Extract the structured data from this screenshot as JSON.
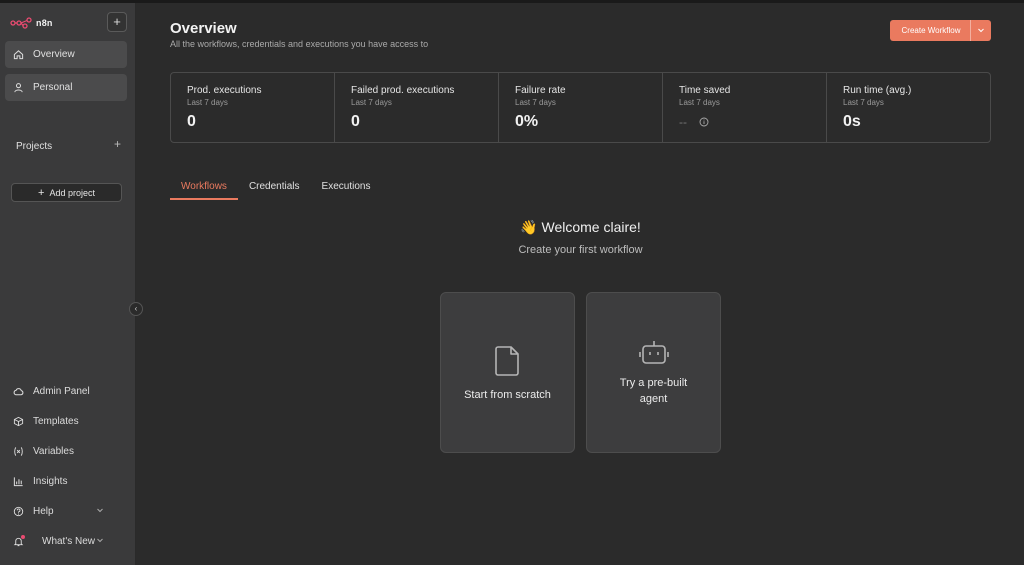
{
  "app": {
    "logo_text": "n8n"
  },
  "sidebar": {
    "nav": [
      {
        "label": "Overview",
        "icon": "home-icon"
      },
      {
        "label": "Personal",
        "icon": "user-icon"
      }
    ],
    "projects_label": "Projects",
    "add_project_label": "Add project",
    "bottom": [
      {
        "label": "Admin Panel",
        "icon": "cloud-icon"
      },
      {
        "label": "Templates",
        "icon": "box-icon"
      },
      {
        "label": "Variables",
        "icon": "variable-icon"
      },
      {
        "label": "Insights",
        "icon": "bar-chart-icon"
      },
      {
        "label": "Help",
        "icon": "help-icon"
      },
      {
        "label": "What's New",
        "icon": "bell-icon"
      }
    ]
  },
  "header": {
    "title": "Overview",
    "subtitle": "All the workflows, credentials and executions you have access to",
    "create_label": "Create Workflow"
  },
  "stats": [
    {
      "label": "Prod. executions",
      "sub": "Last 7 days",
      "value": "0"
    },
    {
      "label": "Failed prod. executions",
      "sub": "Last 7 days",
      "value": "0"
    },
    {
      "label": "Failure rate",
      "sub": "Last 7 days",
      "value": "0%"
    },
    {
      "label": "Time saved",
      "sub": "Last 7 days",
      "value": "--"
    },
    {
      "label": "Run time (avg.)",
      "sub": "Last 7 days",
      "value": "0s"
    }
  ],
  "tabs": [
    {
      "label": "Workflows",
      "active": true
    },
    {
      "label": "Credentials",
      "active": false
    },
    {
      "label": "Executions",
      "active": false
    }
  ],
  "welcome": {
    "title": "👋 Welcome claire!",
    "subtitle": "Create your first workflow"
  },
  "cards": [
    {
      "label": "Start from scratch",
      "icon": "file-icon"
    },
    {
      "label": "Try a pre-built agent",
      "icon": "robot-icon"
    }
  ],
  "colors": {
    "accent": "#ea7a5f",
    "sidebar_bg": "#3a3a3b",
    "main_bg": "#2b2b2b"
  }
}
